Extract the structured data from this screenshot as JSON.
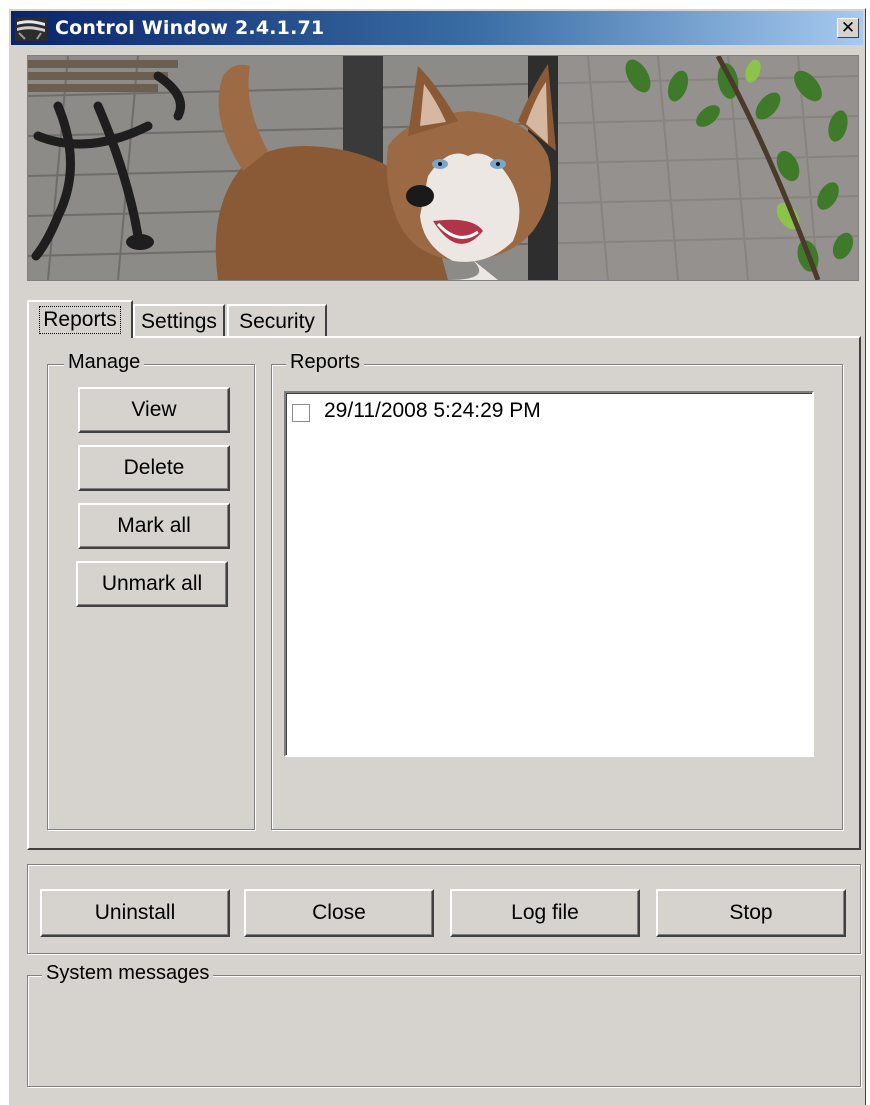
{
  "window": {
    "title": "Control Window  2.4.1.71",
    "close_symbol": "✕"
  },
  "tabs": [
    {
      "label": "Reports",
      "active": true
    },
    {
      "label": "Settings",
      "active": false
    },
    {
      "label": "Security",
      "active": false
    }
  ],
  "manage": {
    "label": "Manage",
    "buttons": [
      "View",
      "Delete",
      "Mark all",
      "Unmark all"
    ]
  },
  "reports": {
    "label": "Reports",
    "items": [
      {
        "text": "29/11/2008 5:24:29 PM",
        "checked": false
      }
    ]
  },
  "actions": {
    "uninstall": "Uninstall",
    "close": "Close",
    "log_file": "Log file",
    "stop": "Stop"
  },
  "system_messages": {
    "label": "System messages"
  },
  "colors": {
    "face": "#d6d3ce",
    "title_start": "#0a246a",
    "title_end": "#a6caf0"
  }
}
